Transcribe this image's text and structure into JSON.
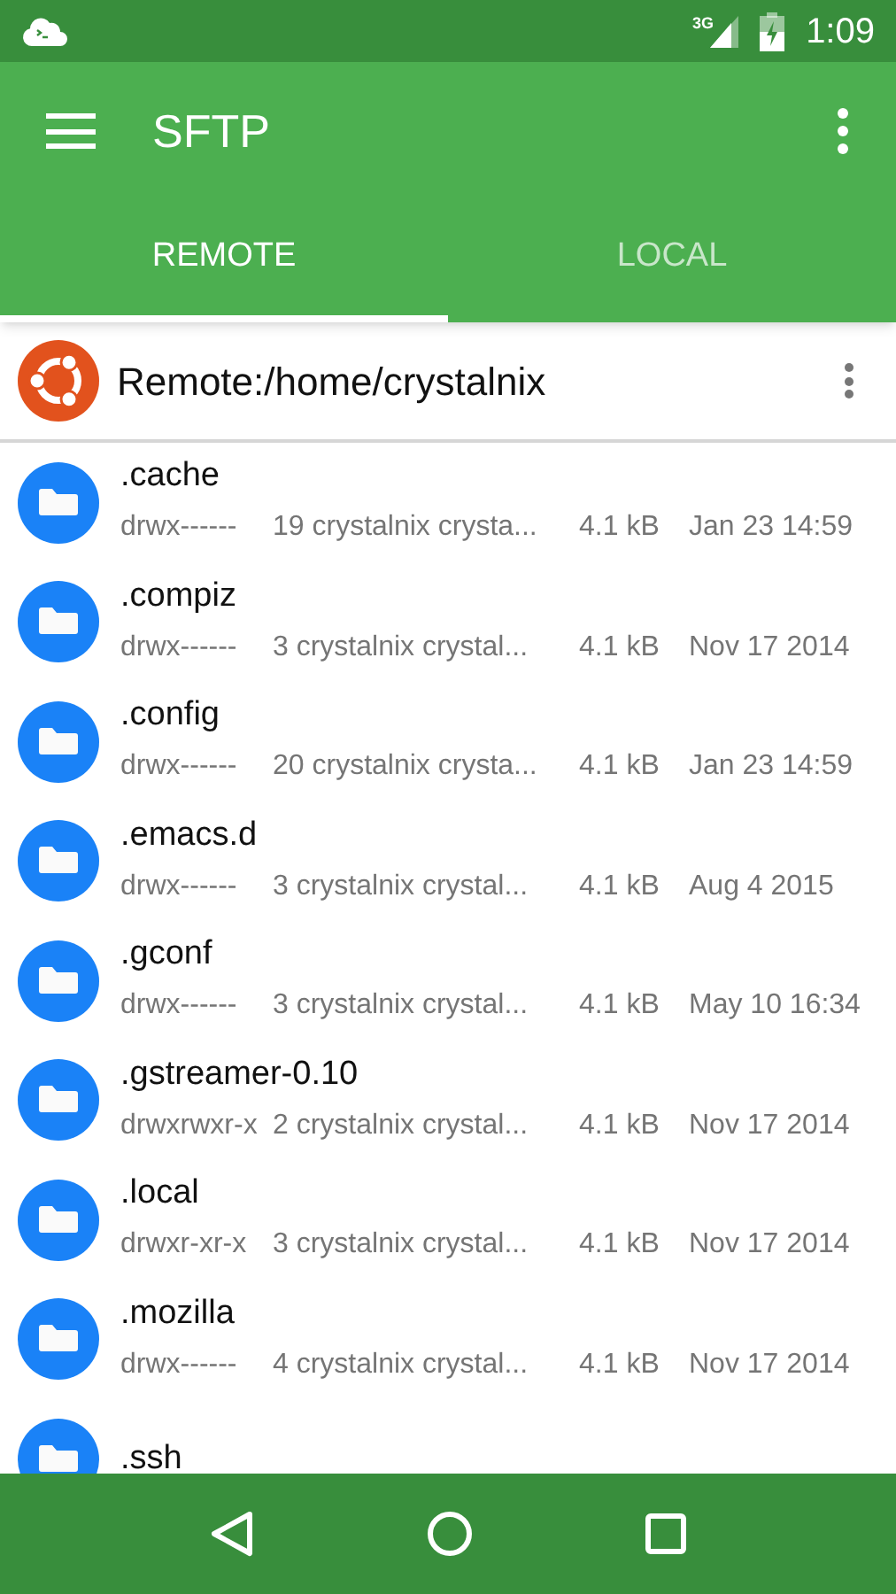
{
  "status_bar": {
    "network": "3G",
    "time": "1:09"
  },
  "toolbar": {
    "title": "SFTP"
  },
  "tabs": [
    {
      "label": "REMOTE",
      "selected": true
    },
    {
      "label": "LOCAL",
      "selected": false
    }
  ],
  "path_bar": {
    "path": "Remote:/home/crystalnix"
  },
  "files": [
    {
      "name": ".cache",
      "permissions": "drwx------",
      "owner": "19 crystalnix crysta...",
      "size": "4.1 kB",
      "modified": "Jan 23 14:59"
    },
    {
      "name": ".compiz",
      "permissions": "drwx------",
      "owner": "3 crystalnix crystal...",
      "size": "4.1 kB",
      "modified": "Nov 17 2014"
    },
    {
      "name": ".config",
      "permissions": "drwx------",
      "owner": "20 crystalnix crysta...",
      "size": "4.1 kB",
      "modified": "Jan 23 14:59"
    },
    {
      "name": ".emacs.d",
      "permissions": "drwx------",
      "owner": "3 crystalnix crystal...",
      "size": "4.1 kB",
      "modified": "Aug 4 2015"
    },
    {
      "name": ".gconf",
      "permissions": "drwx------",
      "owner": "3 crystalnix crystal...",
      "size": "4.1 kB",
      "modified": "May 10 16:34"
    },
    {
      "name": ".gstreamer-0.10",
      "permissions": "drwxrwxr-x",
      "owner": "2 crystalnix crystal...",
      "size": "4.1 kB",
      "modified": "Nov 17 2014"
    },
    {
      "name": ".local",
      "permissions": "drwxr-xr-x",
      "owner": "3 crystalnix crystal...",
      "size": "4.1 kB",
      "modified": "Nov 17 2014"
    },
    {
      "name": ".mozilla",
      "permissions": "drwx------",
      "owner": "4 crystalnix crystal...",
      "size": "4.1 kB",
      "modified": "Nov 17 2014"
    },
    {
      "name": ".ssh"
    }
  ]
}
